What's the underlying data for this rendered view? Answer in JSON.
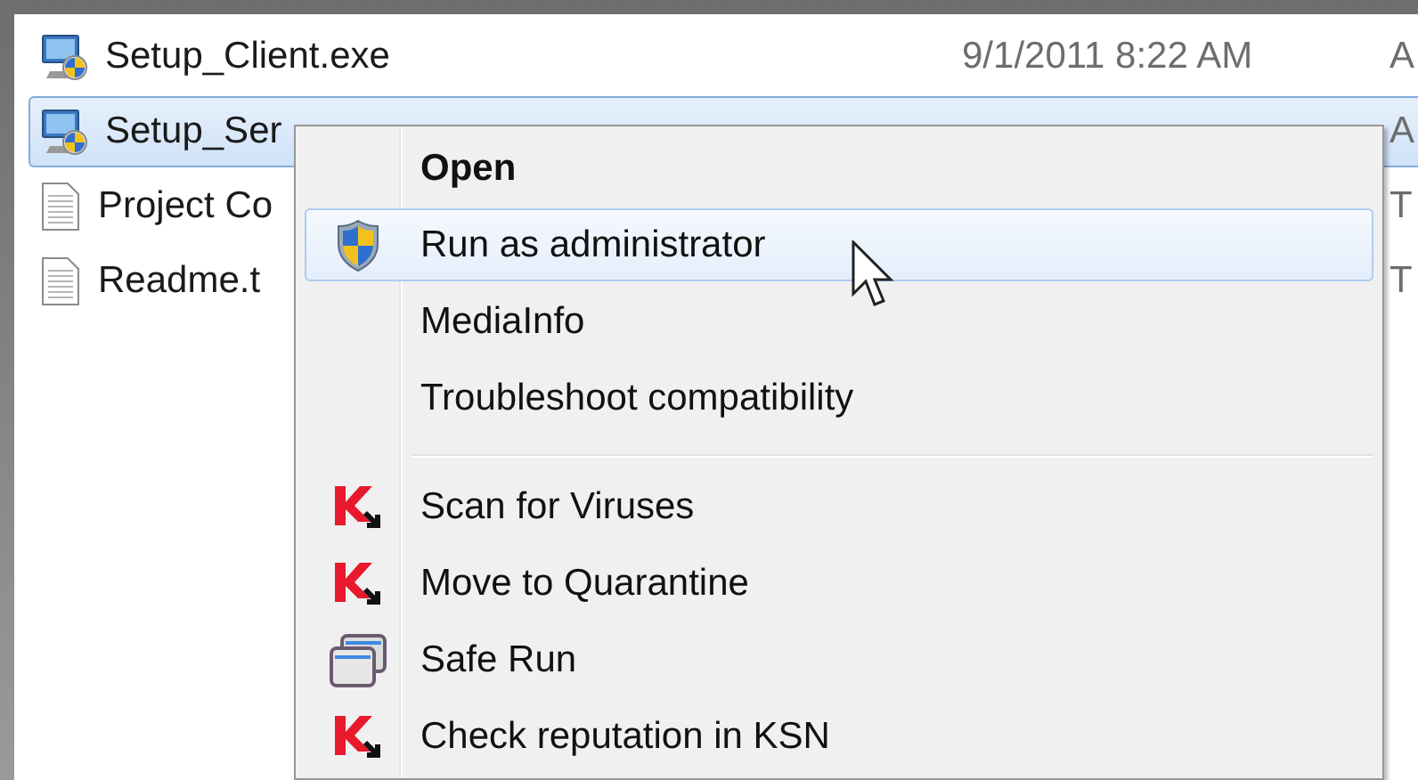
{
  "files": [
    {
      "name": "Setup_Client.exe",
      "kind": "installer",
      "date": "9/1/2011 8:22 AM",
      "column_3": "A",
      "selected": false
    },
    {
      "name": "Setup_Ser",
      "kind": "installer",
      "column_3": "A",
      "selected": true
    },
    {
      "name": "Project Co",
      "kind": "text",
      "column_3": "T",
      "selected": false
    },
    {
      "name": "Readme.t",
      "kind": "text",
      "column_3": "T",
      "selected": false
    }
  ],
  "context_menu": {
    "sections": [
      [
        {
          "label": "Open",
          "kind": "default",
          "selected": false
        },
        {
          "label": "Run as administrator",
          "kind": "elevated",
          "selected": true
        },
        {
          "label": "MediaInfo",
          "kind": "plain",
          "selected": false
        },
        {
          "label": "Troubleshoot compatibility",
          "kind": "plain",
          "selected": false
        }
      ],
      [
        {
          "label": "Scan for Viruses",
          "kind": "antivirus",
          "selected": false
        },
        {
          "label": "Move to Quarantine",
          "kind": "antivirus",
          "selected": false
        },
        {
          "label": "Safe Run",
          "kind": "sandbox",
          "selected": false
        },
        {
          "label": "Check reputation in KSN",
          "kind": "antivirus",
          "selected": false
        }
      ]
    ]
  }
}
